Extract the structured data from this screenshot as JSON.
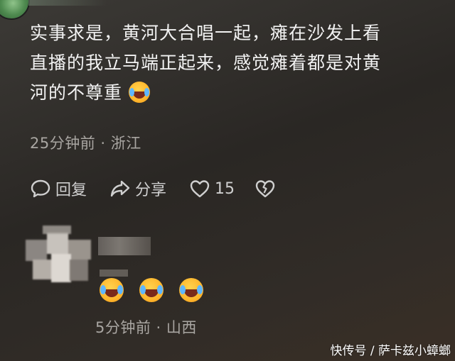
{
  "comment": {
    "line1": "实事求是，黄河大合唱一起，瘫在沙发上看",
    "line2": "直播的我立马端正起来，感觉瘫着都是对黄",
    "line3": "河的不尊重",
    "emoji": "laughing-crying-emoji",
    "time_location": "25分钟前 · 浙江"
  },
  "actions": {
    "reply_label": "回复",
    "share_label": "分享",
    "like_count": "15"
  },
  "reply": {
    "emojis": [
      "laughing-crying-emoji",
      "laughing-crying-emoji",
      "laughing-crying-emoji"
    ],
    "time_location": "5分钟前 · 山西"
  },
  "watermark": "快传号 / 萨卡兹小蟑螂"
}
